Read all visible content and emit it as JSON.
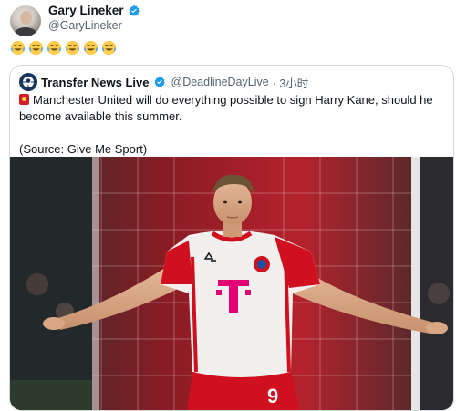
{
  "tweet": {
    "author": {
      "display_name": "Gary Lineker",
      "handle": "@GaryLineker",
      "verified": true,
      "verified_color": "#1d9bf0"
    },
    "text_emojis": [
      "😂",
      "😂",
      "😂",
      "😂",
      "😂",
      "😂"
    ]
  },
  "quoted_tweet": {
    "author": {
      "display_name": "Transfer News Live",
      "handle": "@DeadlineDayLive",
      "time": "· 3小时",
      "verified": true
    },
    "body_line1": "Manchester United will do everything possible to sign Harry Kane, should he become available this summer.",
    "body_line2": "(Source: Give Me Sport)",
    "flag_emoji": "red-flag-icon",
    "image": {
      "subject": "player-celebrating",
      "shirt_number": "9",
      "shirt_sponsor": "T",
      "colors": {
        "shirt": "#f2f0ee",
        "sleeves": "#d0101f",
        "shorts": "#d0101f"
      }
    }
  }
}
